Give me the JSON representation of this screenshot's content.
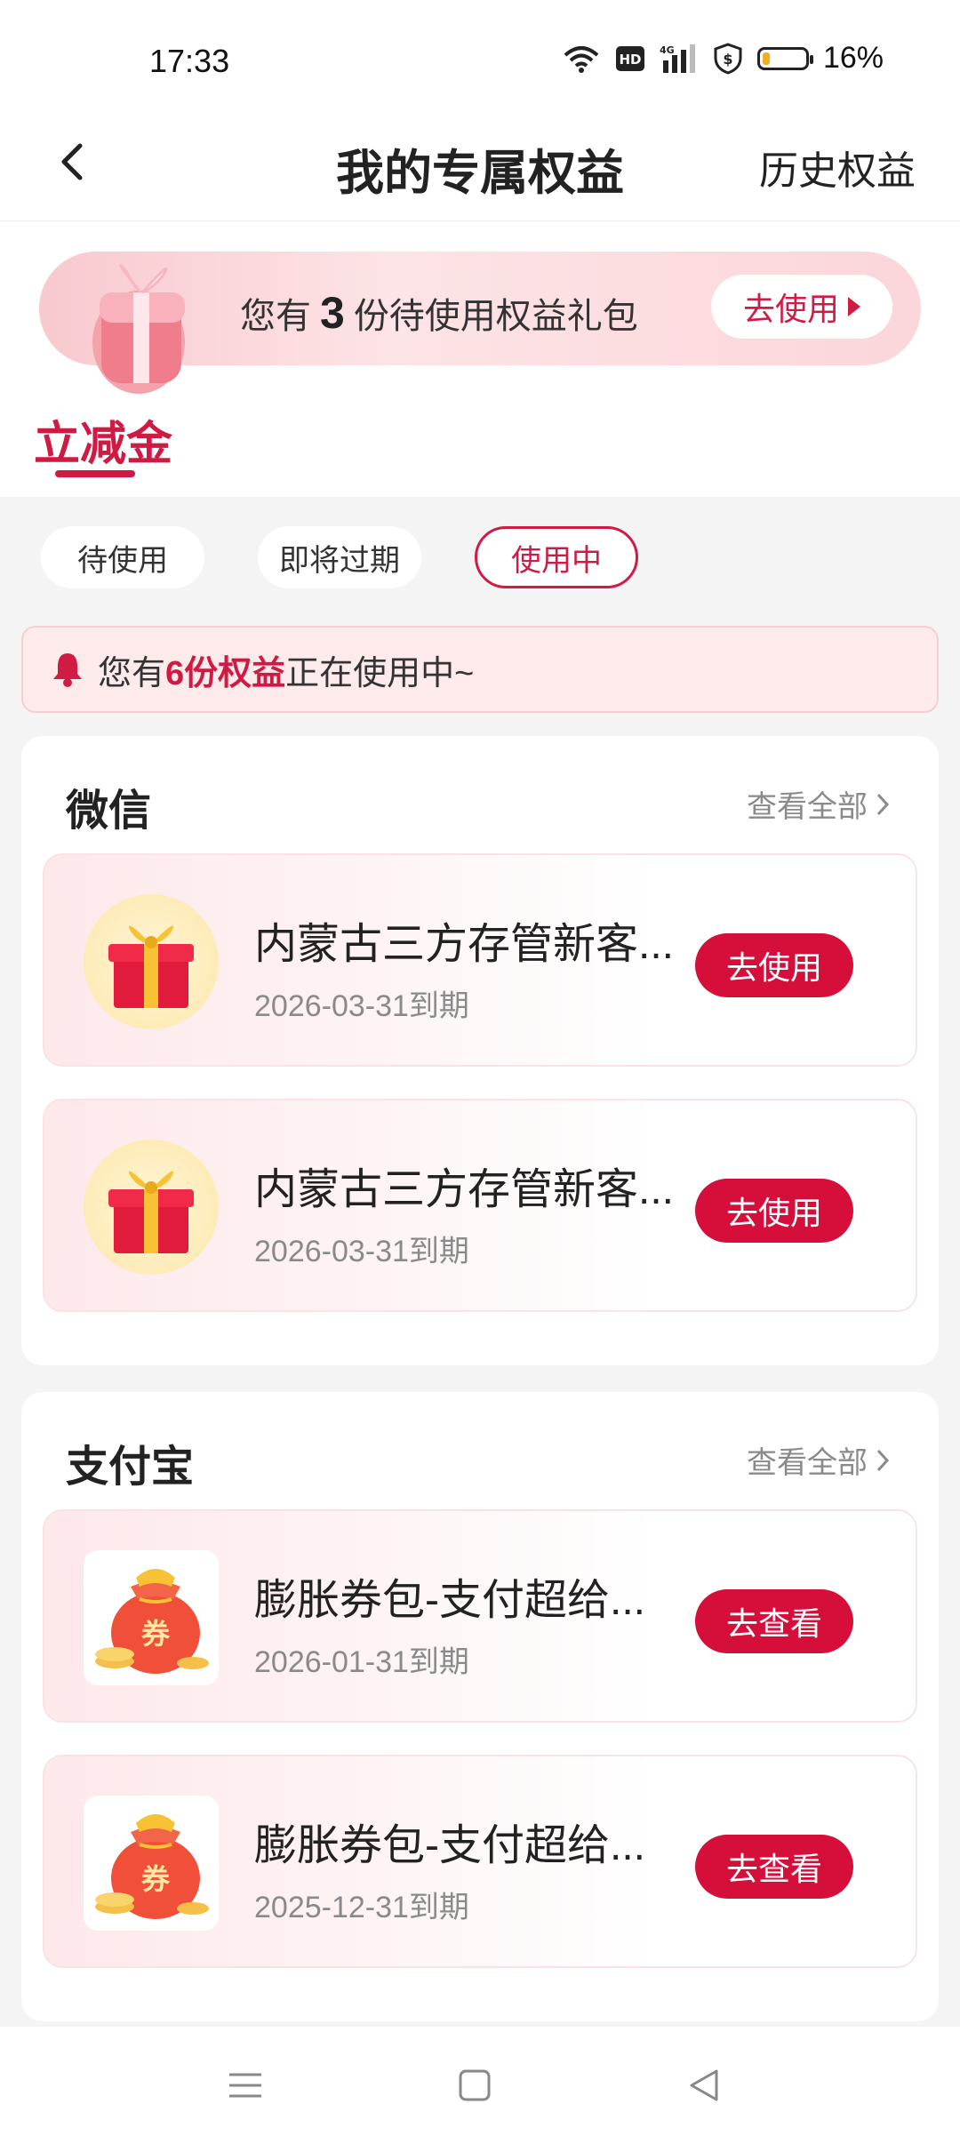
{
  "status_bar": {
    "time": "17:33",
    "battery_percent": "16%",
    "battery_level": 0.16
  },
  "nav": {
    "title": "我的专属权益",
    "history_label": "历史权益"
  },
  "banner": {
    "text_prefix": "您有",
    "count": "3",
    "text_suffix": "份待使用权益礼包",
    "button_label": "去使用"
  },
  "main_tab": {
    "label": "立减金"
  },
  "filters": [
    {
      "label": "待使用",
      "active": false
    },
    {
      "label": "即将过期",
      "active": false
    },
    {
      "label": "使用中",
      "active": true
    }
  ],
  "notice": {
    "prefix": "您有",
    "highlight": "6份权益",
    "suffix": "正在使用中~"
  },
  "sections": [
    {
      "title": "微信",
      "more_label": "查看全部",
      "items": [
        {
          "name": "内蒙古三方存管新客...",
          "date": "2026-03-31到期",
          "button": "去使用",
          "icon": "gift-box-icon"
        },
        {
          "name": "内蒙古三方存管新客...",
          "date": "2026-03-31到期",
          "button": "去使用",
          "icon": "gift-box-icon"
        }
      ]
    },
    {
      "title": "支付宝",
      "more_label": "查看全部",
      "items": [
        {
          "name": "膨胀券包-支付超给...",
          "date": "2026-01-31到期",
          "button": "去查看",
          "icon": "coupon-bag-icon",
          "icon_text": "券"
        },
        {
          "name": "膨胀券包-支付超给...",
          "date": "2025-12-31到期",
          "button": "去查看",
          "icon": "coupon-bag-icon",
          "icon_text": "券"
        }
      ]
    }
  ],
  "colors": {
    "accent": "#d01b45",
    "button_red": "#d50f3a",
    "background": "#f4f4f4"
  }
}
